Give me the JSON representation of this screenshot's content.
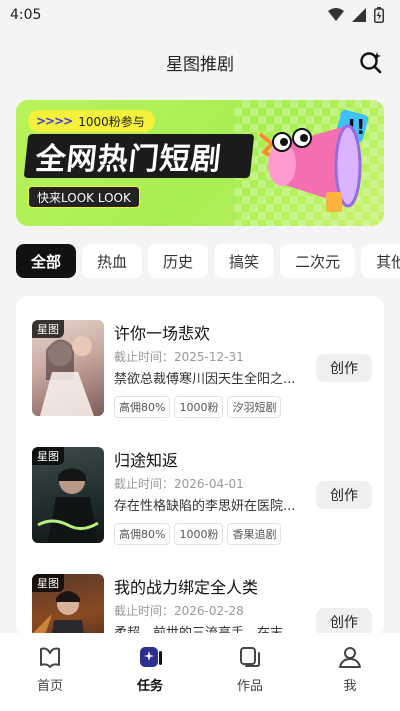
{
  "status_bar": {
    "time": "4:05",
    "icons": [
      "wifi-icon",
      "signal-icon",
      "battery-icon"
    ]
  },
  "header": {
    "title": "星图推剧",
    "search_icon": "search-sparkle-icon"
  },
  "banner": {
    "pill_text": "1000粉参与",
    "pill_arrows": ">>>>",
    "title": "全网热门短剧",
    "subtitle": "快来LOOK LOOK",
    "colors": {
      "background": "#a7ee53",
      "accent": "#f5f13a",
      "megaphone": "#f46fb0"
    }
  },
  "tabs": [
    {
      "label": "全部",
      "active": true
    },
    {
      "label": "热血",
      "active": false
    },
    {
      "label": "历史",
      "active": false
    },
    {
      "label": "搞笑",
      "active": false
    },
    {
      "label": "二次元",
      "active": false
    },
    {
      "label": "其他",
      "active": false
    }
  ],
  "items": [
    {
      "badge": "星图",
      "title": "许你一场悲欢",
      "deadline": "截止时间：2025-12-31",
      "desc": "禁欲总裁傅寒川因天生全阳之...",
      "tags": [
        "高佣80%",
        "1000粉",
        "汐羽短剧"
      ],
      "button": "创作"
    },
    {
      "badge": "星图",
      "title": "归途知返",
      "deadline": "截止时间：2026-04-01",
      "desc": "存在性格缺陷的李思妍在医院...",
      "tags": [
        "高佣80%",
        "1000粉",
        "香果追剧"
      ],
      "button": "创作"
    },
    {
      "badge": "星图",
      "title": "我的战力绑定全人类",
      "deadline": "截止时间：2026-02-28",
      "desc": "柔超，前世的三流高手，在末...",
      "tags": [],
      "button": "创作"
    }
  ],
  "bottom_nav": [
    {
      "label": "首页",
      "icon": "home-icon",
      "active": false
    },
    {
      "label": "任务",
      "icon": "task-icon",
      "active": true
    },
    {
      "label": "作品",
      "icon": "works-icon",
      "active": false
    },
    {
      "label": "我",
      "icon": "profile-icon",
      "active": false
    }
  ]
}
